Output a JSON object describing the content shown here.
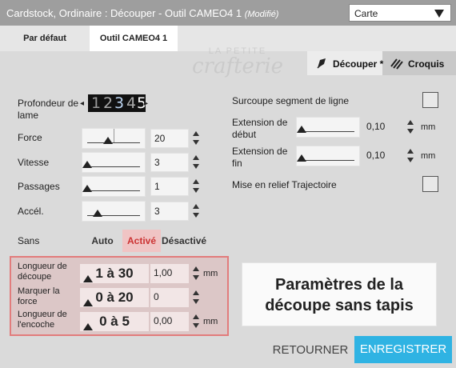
{
  "titlebar": {
    "title": "Cardstock, Ordinaire : Découper - Outil CAMEO4 1",
    "modified": "(Modifié)",
    "material_value": "Carte"
  },
  "tabs": [
    {
      "label": "Par défaut"
    },
    {
      "label": "Outil CAMEO4 1"
    }
  ],
  "watermark": {
    "line1": "LA PETITE",
    "line2": "crafterie"
  },
  "modes": {
    "cut_label": "Découper *",
    "sketch_label": "Croquis"
  },
  "left": {
    "depth_label": "Profondeur de lame",
    "depth_digits": [
      "1",
      "2",
      "3",
      "4",
      "5"
    ],
    "depth_value": 3,
    "force": {
      "label": "Force",
      "value": "20",
      "level": 0.4
    },
    "speed": {
      "label": "Vitesse",
      "value": "3",
      "level": 0.0
    },
    "passes": {
      "label": "Passages",
      "value": "1",
      "level": 0.0
    },
    "accel": {
      "label": "Accél.",
      "value": "3",
      "level": 0.2
    }
  },
  "right": {
    "overcut_label": "Surcoupe segment de ligne",
    "start_ext": {
      "label": "Extension de début",
      "value": "0,10",
      "unit": "mm"
    },
    "end_ext": {
      "label": "Extension de fin",
      "value": "0,10",
      "unit": "mm"
    },
    "trace_label": "Mise en relief Trajectoire"
  },
  "matless": {
    "label": "Sans",
    "auto": "Auto",
    "on": "Activé",
    "off": "Désactivé"
  },
  "matless_settings": {
    "cut_length": {
      "label": "Longueur de découpe",
      "range": "1 à 30",
      "value": "1,00",
      "unit": "mm"
    },
    "mark_force": {
      "label": "Marquer la force",
      "range": "0 à 20",
      "value": "0"
    },
    "notch_length": {
      "label": "Longueur de l'encoche",
      "range": "0 à 5",
      "value": "0,00",
      "unit": "mm"
    }
  },
  "callout": {
    "line1": "Paramètres de la",
    "line2": "découpe sans tapis"
  },
  "footer": {
    "back_label": "RETOURNER",
    "save_label": "ENREGISTRER"
  },
  "colors": {
    "accent": "#2fb3e3",
    "highlight_border": "#e27c7c",
    "active_text": "#cc3333"
  }
}
